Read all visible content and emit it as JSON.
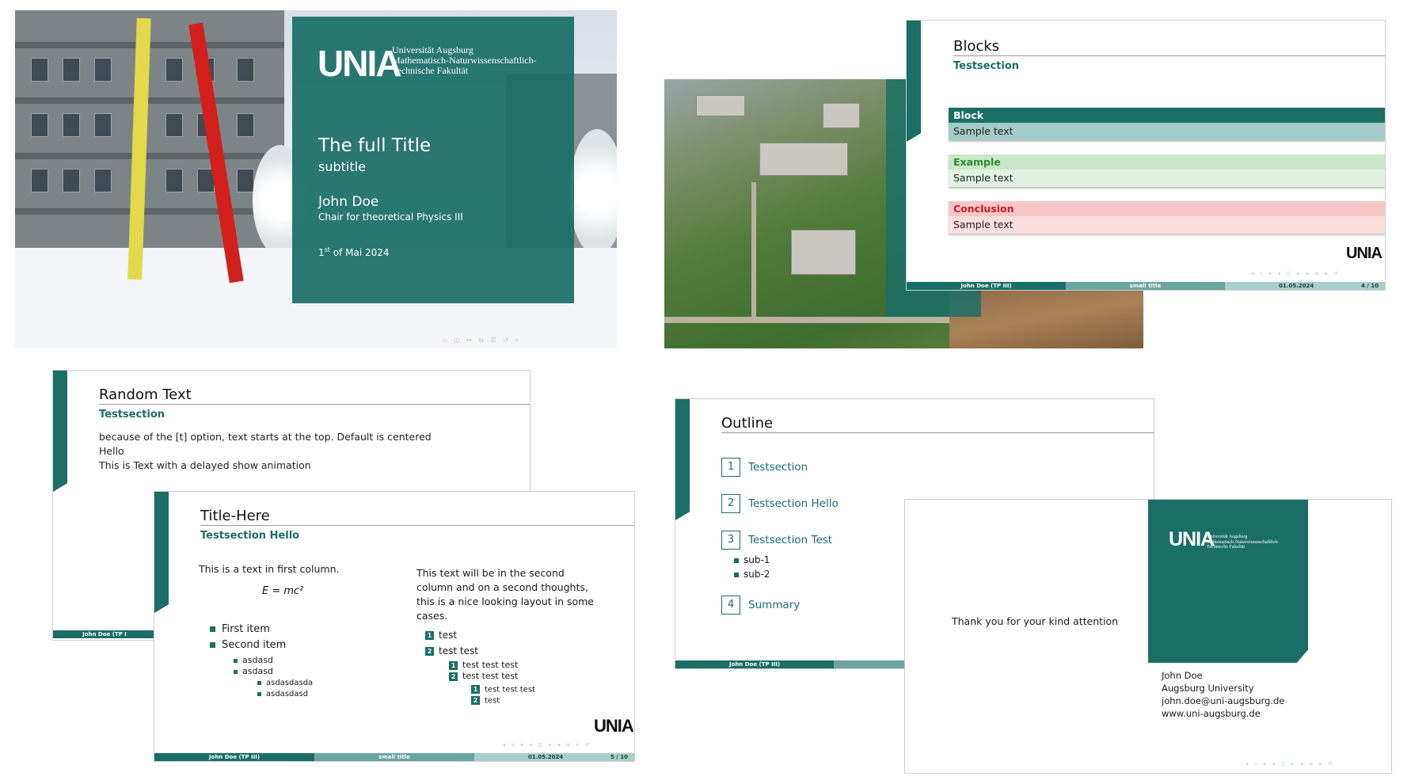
{
  "title_slide": {
    "logo": "UNIA",
    "university_lines": [
      "Universität Augsburg",
      "Mathematisch-Naturwissenschaftlich-",
      "Technische Fakultät"
    ],
    "title": "The full Title",
    "subtitle": "subtitle",
    "author": "John Doe",
    "institute": "Chair for theoretical Physics III",
    "date_day": "1",
    "date_suffix": "st",
    "date_rest": " of Mai 2024",
    "nav_symbols": "▫ ◫ ↔ ⇆ ☰ ↺ ⌕"
  },
  "blocks_slide": {
    "title": "Blocks",
    "section": "Testsection",
    "blocks": [
      {
        "heading": "Block",
        "body": "Sample text"
      },
      {
        "heading": "Example",
        "body": "Sample text"
      },
      {
        "heading": "Conclusion",
        "body": "Sample text"
      }
    ],
    "logo": "UNIA",
    "footer": {
      "author": "John Doe  (TP III)",
      "short_title": "small title",
      "date": "01.05.2024",
      "page": "4 / 10"
    },
    "nav_symbols": "◂ ▫ ▸ ◂ ◫ ▸ ◂ ≡ ▸ ↺"
  },
  "random_slide": {
    "title": "Random Text",
    "section": "Testsection",
    "lines": [
      "because of the [t] option, text starts at the top.  Default is centered",
      "Hello",
      "This is Text with a delayed show animation"
    ],
    "footer_author": "John Doe  (TP I"
  },
  "titlehere_slide": {
    "title": "Title-Here",
    "section": "Testsection Hello",
    "col1_text": "This is a text in first column.",
    "equation": "E = mc²",
    "items": [
      {
        "text": "First item",
        "level": 1
      },
      {
        "text": "Second item",
        "level": 1
      },
      {
        "text": "asdasd",
        "level": 2
      },
      {
        "text": "asdasd",
        "level": 2
      },
      {
        "text": "asdasdasda",
        "level": 3
      },
      {
        "text": "asdasdasd",
        "level": 3
      }
    ],
    "col2_lines": [
      "This text will be in the second",
      "column and on a second thoughts,",
      "this is a nice looking layout in some",
      "cases."
    ],
    "enum": [
      {
        "num": "1",
        "text": "test",
        "level": 1
      },
      {
        "num": "2",
        "text": "test test",
        "level": 1
      },
      {
        "num": "1",
        "text": "test test test",
        "level": 2
      },
      {
        "num": "2",
        "text": "test test test",
        "level": 2
      },
      {
        "num": "1",
        "text": "test test test",
        "level": 3
      },
      {
        "num": "2",
        "text": "test",
        "level": 3
      }
    ],
    "logo": "UNIA",
    "footer": {
      "author": "John Doe  (TP III)",
      "short_title": "small title",
      "date": "01.05.2024",
      "page": "5 / 10"
    }
  },
  "outline_slide": {
    "title": "Outline",
    "entries": [
      {
        "num": "1",
        "text": "Testsection"
      },
      {
        "num": "2",
        "text": "Testsection Hello"
      },
      {
        "num": "3",
        "text": "Testsection Test"
      },
      {
        "num": "4",
        "text": "Summary"
      }
    ],
    "subitems": [
      "sub-1",
      "sub-2"
    ],
    "footer_author": "John Doe  (TP III)"
  },
  "thanks_slide": {
    "message": "Thank you for your kind attention",
    "logo": "UNIA",
    "university_lines": [
      "Universität Augsburg",
      "Mathematisch-Naturwissenschaftlich-",
      "Technische Fakultät"
    ],
    "contact": [
      "John Doe",
      "Augsburg University",
      "john.doe@uni-augsburg.de",
      "www.uni-augsburg.de"
    ]
  },
  "colors": {
    "accent": "#1a6e66",
    "block_header": "#1a6e66",
    "block_body": "#a3ccc8",
    "example_header": "#c9e8c9",
    "example_text": "#2e8b2e",
    "example_body": "#e2f2e2",
    "conclusion_header": "#f8c6c6",
    "conclusion_text": "#c0202a",
    "conclusion_body": "#fbdede"
  }
}
